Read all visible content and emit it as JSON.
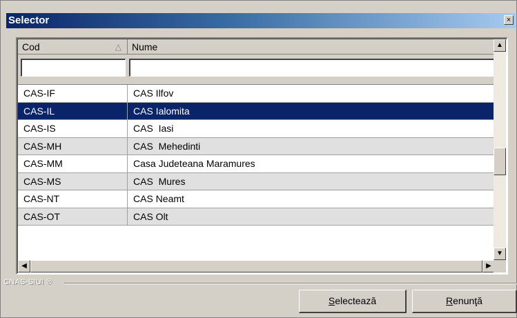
{
  "window": {
    "title": "Selector",
    "close_label": "×"
  },
  "grid": {
    "columns": [
      {
        "label": "Cod",
        "sort_icon": "sort-asc-triangle"
      },
      {
        "label": "Nume"
      }
    ],
    "filters": {
      "cod_value": "",
      "nume_value": ""
    },
    "rows": [
      {
        "cod": "CAS-IF",
        "nume": "CAS Ilfov",
        "selected": false
      },
      {
        "cod": "CAS-IL",
        "nume": "CAS Ialomita",
        "selected": true
      },
      {
        "cod": "CAS-IS",
        "nume": "CAS  Iasi",
        "selected": false
      },
      {
        "cod": "CAS-MH",
        "nume": "CAS  Mehedinti",
        "selected": false
      },
      {
        "cod": "CAS-MM",
        "nume": "Casa Judeteana Maramures",
        "selected": false
      },
      {
        "cod": "CAS-MS",
        "nume": "CAS  Mures",
        "selected": false
      },
      {
        "cod": "CAS-NT",
        "nume": "CAS Neamt",
        "selected": false
      },
      {
        "cod": "CAS-OT",
        "nume": "CAS Olt",
        "selected": false
      }
    ]
  },
  "footer": {
    "group_label": "CNAS-SIUI ®",
    "select_button": {
      "accel": "S",
      "rest": "electează"
    },
    "cancel_button": {
      "accel": "R",
      "rest": "enunţă"
    }
  },
  "colors": {
    "selection": "#0a246a",
    "title_start": "#0a246a",
    "title_end": "#a6caf0",
    "face": "#d4d0c8",
    "alt_row": "#e0e0e0"
  }
}
